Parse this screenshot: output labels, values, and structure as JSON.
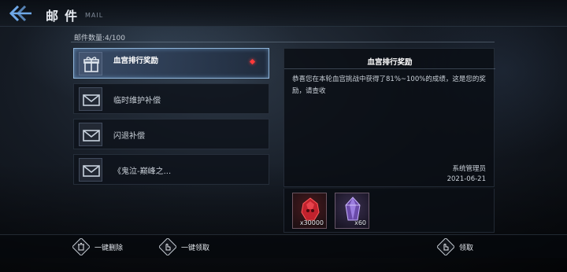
{
  "header": {
    "title": "邮件",
    "subtitle": "MAIL",
    "mail_count_label": "邮件数量:4/100"
  },
  "mail_list": [
    {
      "title": "血宫排行奖励",
      "icon": "gift-icon",
      "unread": true,
      "selected": true
    },
    {
      "title": "临时维护补偿",
      "icon": "envelope-icon",
      "unread": false,
      "selected": false
    },
    {
      "title": "闪退补偿",
      "icon": "envelope-icon",
      "unread": false,
      "selected": false
    },
    {
      "title": "《鬼泣-巅峰之...",
      "icon": "envelope-icon",
      "unread": false,
      "selected": false
    }
  ],
  "detail": {
    "title": "血宫排行奖励",
    "body": "恭喜您在本轮血宫挑战中获得了81%~100%的成绩，这是您的奖励，请查收",
    "sender": "系统管理员",
    "date": "2021-06-21"
  },
  "attachments": [
    {
      "icon": "red-orb-icon",
      "quantity": "x30000"
    },
    {
      "icon": "purple-crystal-icon",
      "quantity": "x60"
    }
  ],
  "actions": {
    "delete_all": "一键删除",
    "claim_all": "一键领取",
    "claim": "领取"
  },
  "colors": {
    "accent": "#8fb4d8",
    "unread_dot": "#ff3a3a",
    "back_arrow": "#6fa8e8"
  }
}
